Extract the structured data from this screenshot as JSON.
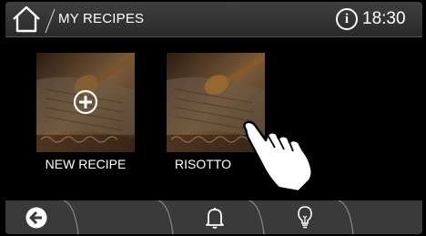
{
  "header": {
    "title": "MY RECIPES",
    "info_glyph": "i",
    "time": "18:30",
    "home_icon": "home-icon",
    "info_icon": "info-icon"
  },
  "tiles": [
    {
      "label": "NEW RECIPE",
      "icon": "plus-circle-icon"
    },
    {
      "label": "RISOTTO",
      "icon": "recipe-book-image"
    }
  ],
  "bottom_bar": {
    "buttons": [
      "back-icon",
      "bell-icon",
      "lightbulb-icon"
    ]
  },
  "colors": {
    "background": "#000000",
    "header": "#333333",
    "bottom_bar": "#3a3a3a",
    "text": "#ffffff"
  }
}
